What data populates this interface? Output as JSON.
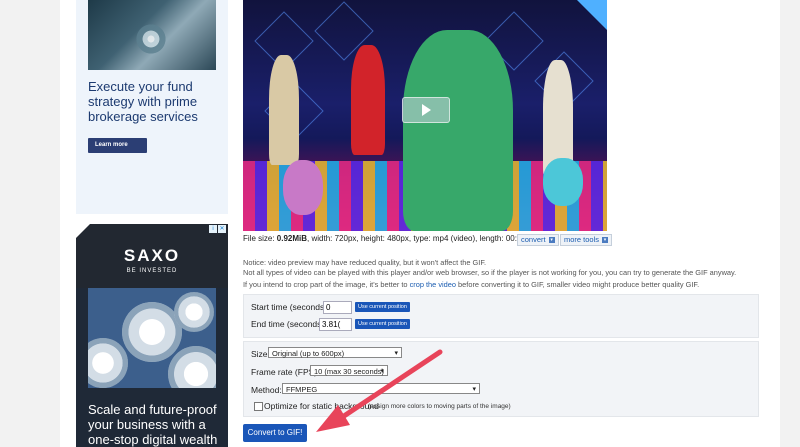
{
  "ads": {
    "ad1": {
      "headline": "Execute your fund strategy with prime brokerage services",
      "button": "Learn more"
    },
    "ad2": {
      "logo": "SAXO",
      "tagline": "BE INVESTED",
      "headline": "Scale and future-proof your business with a one-stop digital wealth"
    }
  },
  "video": {
    "play_icon": "play-icon"
  },
  "file_info": {
    "prefix": "File size: ",
    "size": "0.92MiB",
    "rest": ", width: 720px, height: 480px, type: mp4 (video), length: 00:00:03",
    "convert_label": "convert",
    "more_tools_label": "more tools"
  },
  "notices": {
    "line1": "Notice: video preview may have reduced quality, but it won't affect the GIF.",
    "line2": "Not all types of video can be played with this player and/or web browser, so if the player is not working for you, you can try to generate the GIF anyway.",
    "line3_pre": "If you intend to crop part of the image, it's better to ",
    "line3_link": "crop the video",
    "line3_post": " before converting it to GIF, smaller video might produce better quality GIF."
  },
  "time_panel": {
    "start_label": "Start time (seconds):",
    "start_value": "0",
    "end_label": "End time (seconds):",
    "end_value": "3.81(",
    "use_current": "Use current position"
  },
  "options": {
    "size_label": "Size:",
    "size_value": "Original (up to 600px)",
    "fps_label": "Frame rate (FPS):",
    "fps_value": "10 (max 30 seconds)",
    "method_label": "Method:",
    "method_value": "FFMPEG",
    "optimize_label": "Optimize for static background",
    "optimize_note": "(assign more colors to moving parts of the image)"
  },
  "convert_button": "Convert to GIF!",
  "colors": {
    "accent": "#1a56b8",
    "arrow": "#e8445a"
  }
}
